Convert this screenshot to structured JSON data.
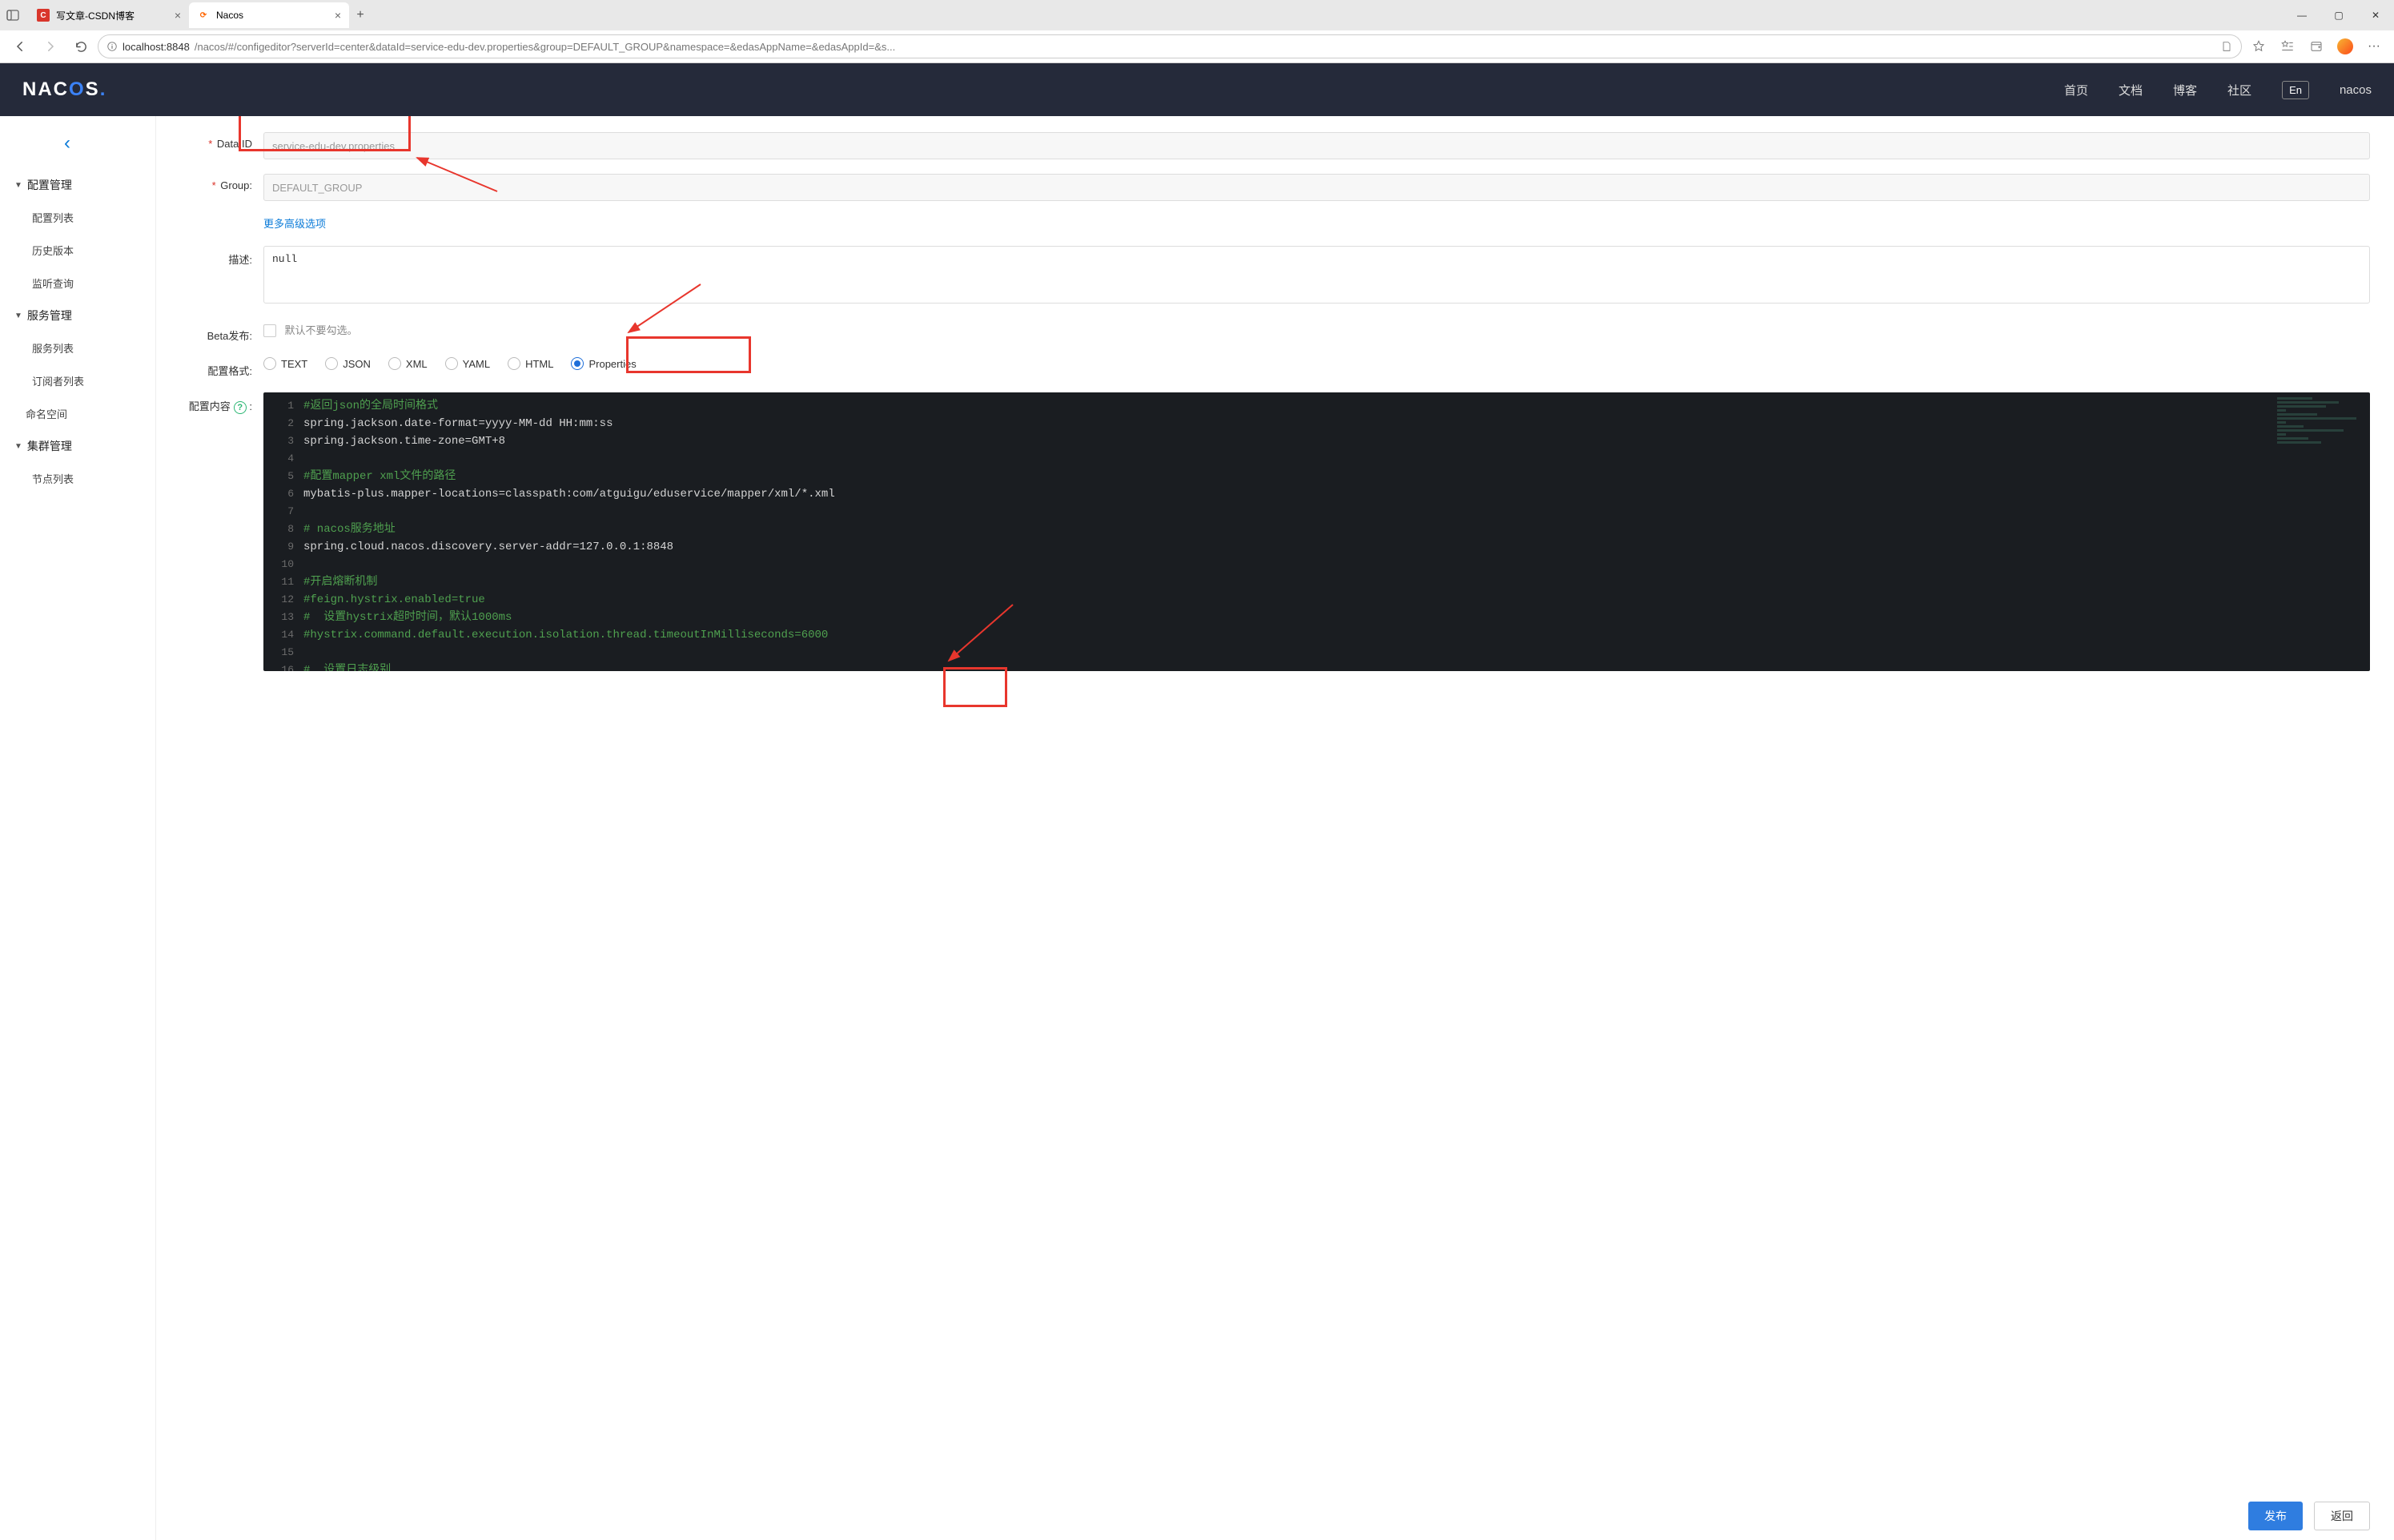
{
  "browser": {
    "tabs": [
      {
        "title": "写文章-CSDN博客",
        "favicon_bg": "#d9362b",
        "favicon_char": "C",
        "favicon_color": "#fff",
        "active": false
      },
      {
        "title": "Nacos",
        "favicon_bg": "transparent",
        "favicon_char": "⟳",
        "favicon_color": "#f60",
        "active": true
      }
    ],
    "url_host": "localhost",
    "url_port": ":8848",
    "url_path": "/nacos/#/configeditor?serverId=center&dataId=service-edu-dev.properties&group=DEFAULT_GROUP&namespace=&edasAppName=&edasAppId=&s..."
  },
  "header": {
    "logo_text": "NACOS.",
    "nav": [
      "首页",
      "文档",
      "博客",
      "社区"
    ],
    "lang": "En",
    "user": "nacos"
  },
  "sidebar": {
    "groups": [
      {
        "title": "配置管理",
        "items": [
          "配置列表",
          "历史版本",
          "监听查询"
        ]
      },
      {
        "title": "服务管理",
        "items": [
          "服务列表",
          "订阅者列表"
        ]
      },
      {
        "title": "命名空间",
        "items": [],
        "flat": true
      },
      {
        "title": "集群管理",
        "items": [
          "节点列表"
        ]
      }
    ]
  },
  "form": {
    "data_id_label": "Data ID",
    "data_id_value": "service-edu-dev.properties",
    "group_label": "Group:",
    "group_value": "DEFAULT_GROUP",
    "adv_link": "更多高级选项",
    "desc_label": "描述:",
    "desc_value": "null",
    "beta_label": "Beta发布:",
    "beta_text": "默认不要勾选。",
    "format_label": "配置格式:",
    "formats": [
      "TEXT",
      "JSON",
      "XML",
      "YAML",
      "HTML",
      "Properties"
    ],
    "format_selected": "Properties",
    "content_label": "配置内容"
  },
  "editor_lines": [
    {
      "n": 1,
      "type": "comment",
      "text": "#返回json的全局时间格式"
    },
    {
      "n": 2,
      "type": "kv",
      "key": "spring.jackson.date-format",
      "val": "yyyy-MM-dd HH:mm:ss"
    },
    {
      "n": 3,
      "type": "kv",
      "key": "spring.jackson.time-zone",
      "val": "GMT+8"
    },
    {
      "n": 4,
      "type": "blank",
      "text": ""
    },
    {
      "n": 5,
      "type": "comment",
      "text": "#配置mapper xml文件的路径"
    },
    {
      "n": 6,
      "type": "kv",
      "key": "mybatis-plus.mapper-locations",
      "val": "classpath:com/atguigu/eduservice/mapper/xml/*.xml"
    },
    {
      "n": 7,
      "type": "blank",
      "text": ""
    },
    {
      "n": 8,
      "type": "comment",
      "text": "# nacos服务地址"
    },
    {
      "n": 9,
      "type": "kv",
      "key": "spring.cloud.nacos.discovery.server-addr",
      "val": "127.0.0.1:8848"
    },
    {
      "n": 10,
      "type": "blank",
      "text": ""
    },
    {
      "n": 11,
      "type": "comment",
      "text": "#开启熔断机制"
    },
    {
      "n": 12,
      "type": "comment",
      "text": "#feign.hystrix.enabled=true"
    },
    {
      "n": 13,
      "type": "comment",
      "text": "#  设置hystrix超时时间，默认1000ms"
    },
    {
      "n": 14,
      "type": "comment",
      "text": "#hystrix.command.default.execution.isolation.thread.timeoutInMilliseconds=6000"
    },
    {
      "n": 15,
      "type": "blank",
      "text": ""
    },
    {
      "n": 16,
      "type": "comment",
      "text": "#  设置日志级别"
    }
  ],
  "buttons": {
    "publish": "发布",
    "back": "返回"
  }
}
